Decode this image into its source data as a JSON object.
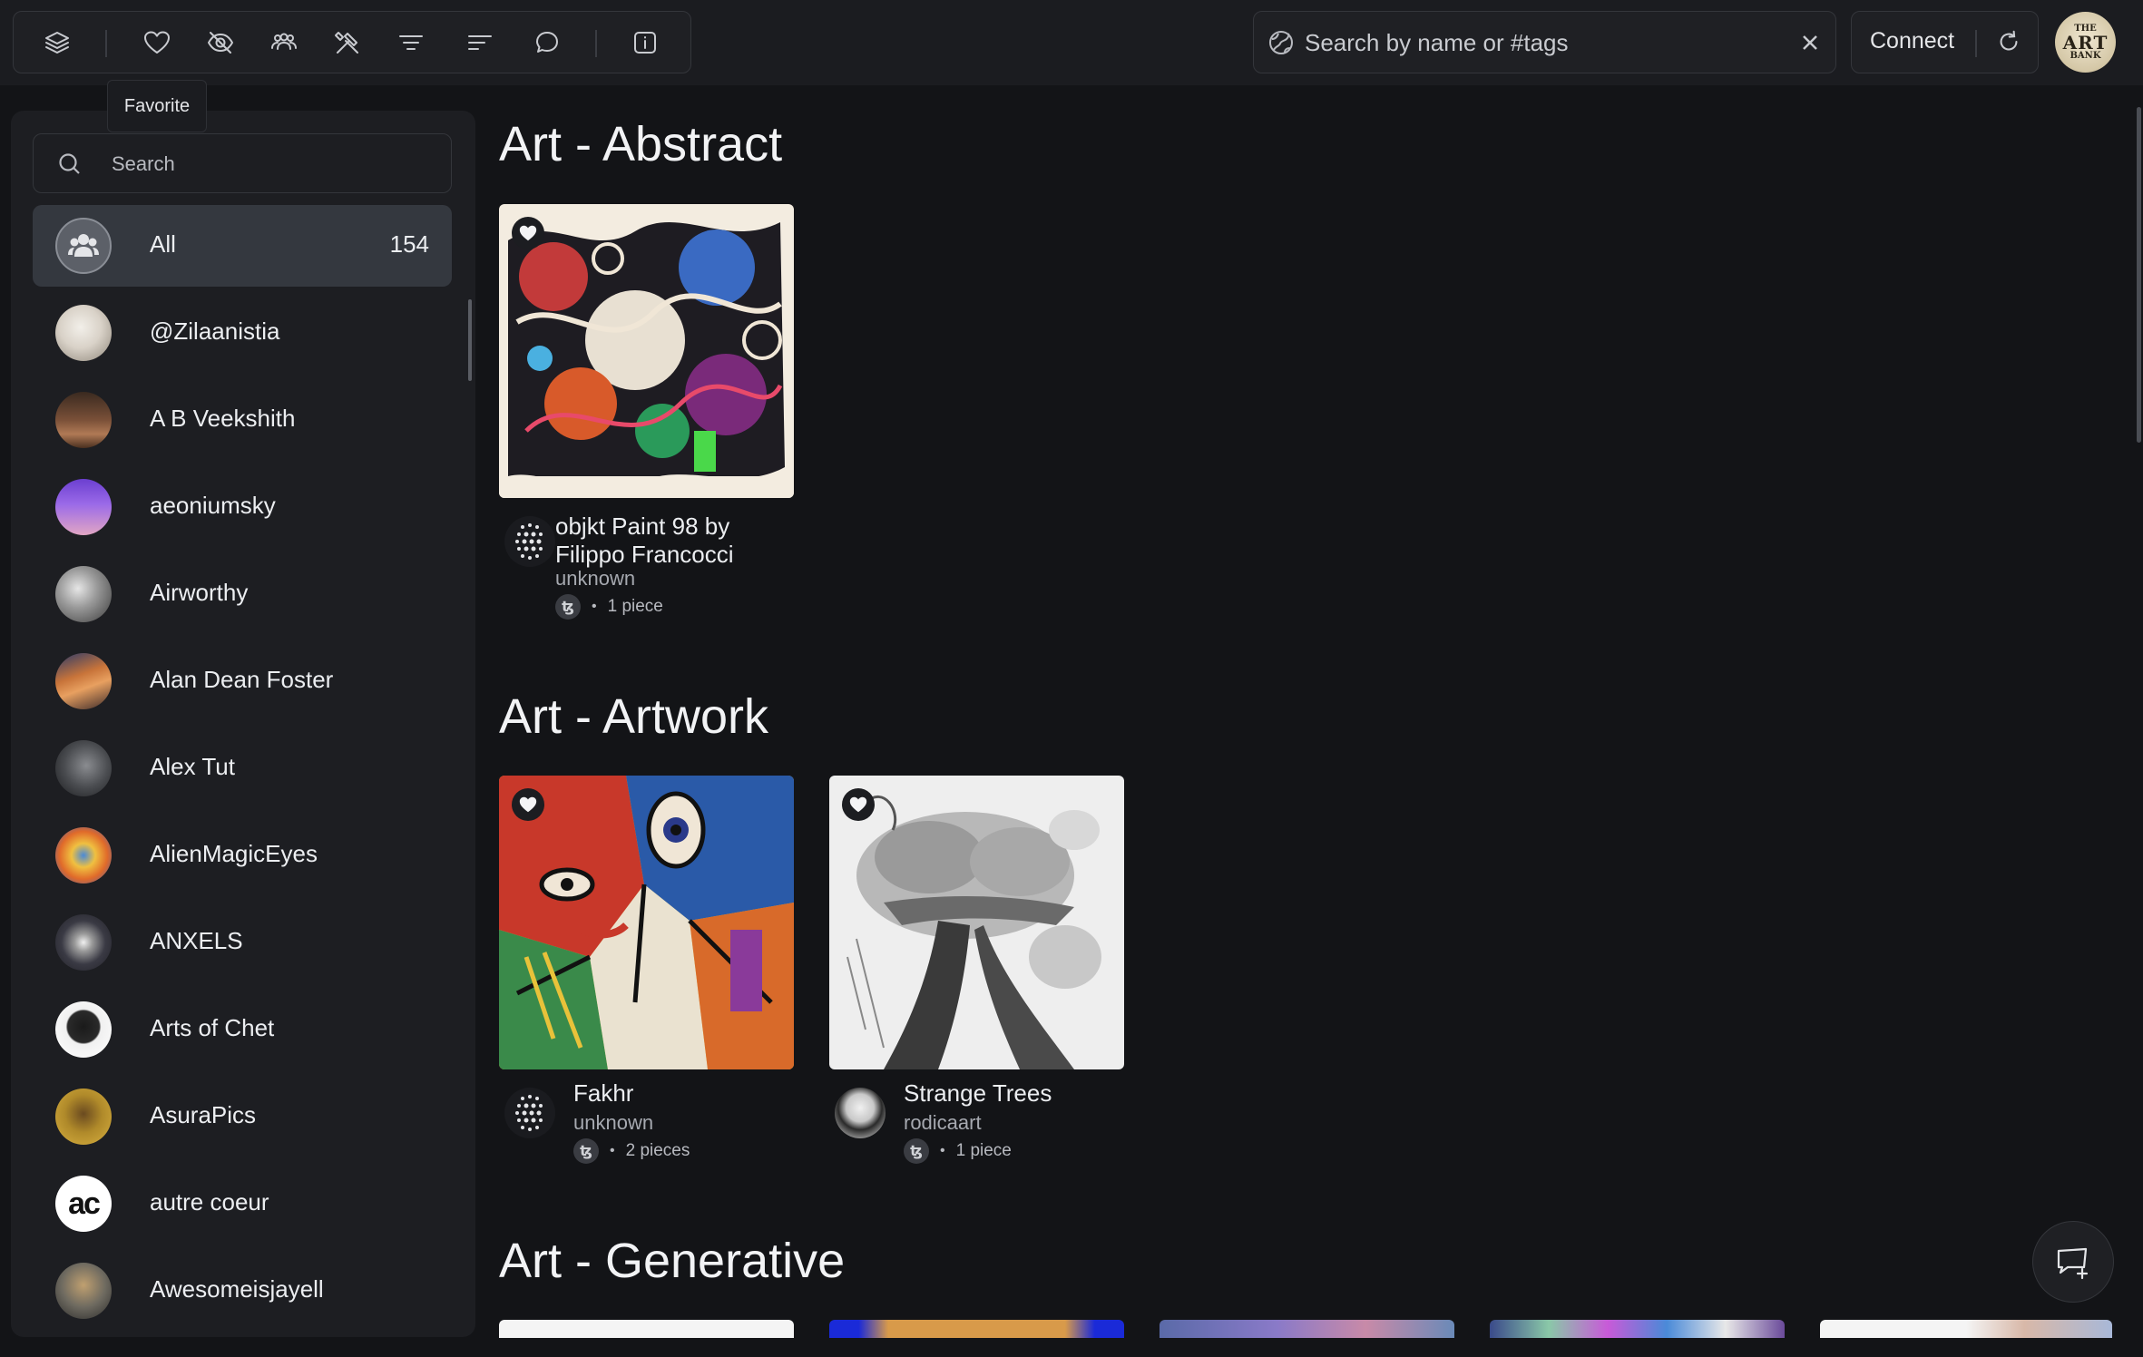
{
  "toolbar": {
    "tooltip": "Favorite",
    "icons": [
      "layers-icon",
      "heart-icon",
      "hidden-icon",
      "users-icon",
      "tools-icon",
      "filter-icon",
      "sort-icon",
      "chat-icon",
      "info-icon"
    ]
  },
  "search": {
    "placeholder": "Search by name or #tags"
  },
  "header": {
    "connect_label": "Connect"
  },
  "logo": {
    "line1": "THE",
    "line2": "ART",
    "line3": "BANK"
  },
  "sidebar": {
    "search_placeholder": "Search",
    "all": {
      "label": "All",
      "count": "154"
    },
    "items": [
      {
        "label": "@Zilaanistia",
        "color": "#c9c4bd"
      },
      {
        "label": "A B Veekshith",
        "color": "#6d4a34"
      },
      {
        "label": "aeoniumsky",
        "color": "#8a5bd6"
      },
      {
        "label": "Airworthy",
        "color": "#8d8f93"
      },
      {
        "label": "Alan Dean Foster",
        "color": "#b0623a"
      },
      {
        "label": "Alex Tut",
        "color": "#4a4c50"
      },
      {
        "label": "AlienMagicEyes",
        "color": "#d67a2a"
      },
      {
        "label": "ANXELS",
        "color": "#3d3f44"
      },
      {
        "label": "Arts of Chet",
        "color": "#e8e8e8"
      },
      {
        "label": "AsuraPics",
        "color": "#b58f2b"
      },
      {
        "label": "autre coeur",
        "color": "#ffffff"
      },
      {
        "label": "Awesomeisjayell",
        "color": "#6e6a60"
      }
    ]
  },
  "sections": [
    {
      "title": "Art - Abstract",
      "cards": [
        {
          "title": "objkt Paint 98 by Filippo Francocci",
          "creator": "unknown",
          "currency": "ꜩ",
          "pieces": "1 piece"
        }
      ]
    },
    {
      "title": "Art - Artwork",
      "cards": [
        {
          "title": "Fakhr",
          "creator": "unknown",
          "currency": "ꜩ",
          "pieces": "2 pieces"
        },
        {
          "title": "Strange Trees",
          "creator": "rodicaart",
          "currency": "ꜩ",
          "pieces": "1 piece"
        }
      ]
    },
    {
      "title": "Art - Generative",
      "cards": []
    }
  ],
  "colors": {
    "background": "#131417",
    "sidebar": "#1d1e22",
    "active_item": "#34383f"
  }
}
